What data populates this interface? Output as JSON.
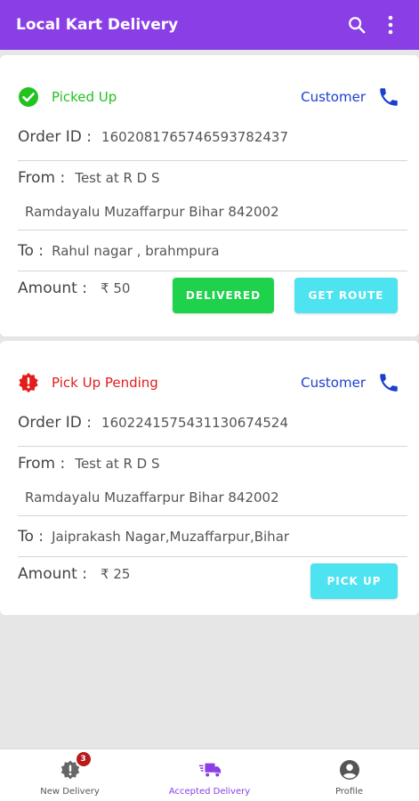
{
  "app": {
    "title": "Local Kart Delivery"
  },
  "colors": {
    "primary": "#8a3ee6",
    "picked_up": "#22c21f",
    "pending": "#e31c1c",
    "customer": "#1b3fd1",
    "delivered_btn": "#1fd24b",
    "get_route_btn": "#4ee3f0",
    "pick_up_btn": "#4ee3f0"
  },
  "orders": [
    {
      "status": "Picked Up",
      "status_icon": "check-circle-icon",
      "customer_label": "Customer",
      "order_id_label": "Order ID :",
      "order_id": "160208176574659378243​7",
      "from_label": "From :",
      "from_name": "Test at R D S",
      "from_address": "Ramdayalu Muzaffarpur Bihar 842002",
      "to_label": "To :",
      "to_address": "Rahul nagar , brahmpura",
      "amount_label": "Amount :",
      "amount": "₹ 50",
      "buttons": [
        "DELIVERED",
        "GET ROUTE"
      ]
    },
    {
      "status": "Pick Up Pending",
      "status_icon": "alert-badge-icon",
      "customer_label": "Customer",
      "order_id_label": "Order ID :",
      "order_id": "160224157543113067452​4",
      "from_label": "From :",
      "from_name": "Test at R D S",
      "from_address": "Ramdayalu Muzaffarpur Bihar 842002",
      "to_label": "To :",
      "to_address": "Jaiprakash Nagar,Muzaffarpur,Bihar",
      "amount_label": "Amount :",
      "amount": "₹ 25",
      "buttons": [
        "PICK UP"
      ]
    }
  ],
  "bottom_nav": [
    {
      "label": "New Delivery",
      "icon": "gear-badge-icon",
      "badge": "3"
    },
    {
      "label": "Accepted Delivery",
      "icon": "delivery-truck-icon",
      "active": true
    },
    {
      "label": "Profile",
      "icon": "account-circle-icon"
    }
  ]
}
